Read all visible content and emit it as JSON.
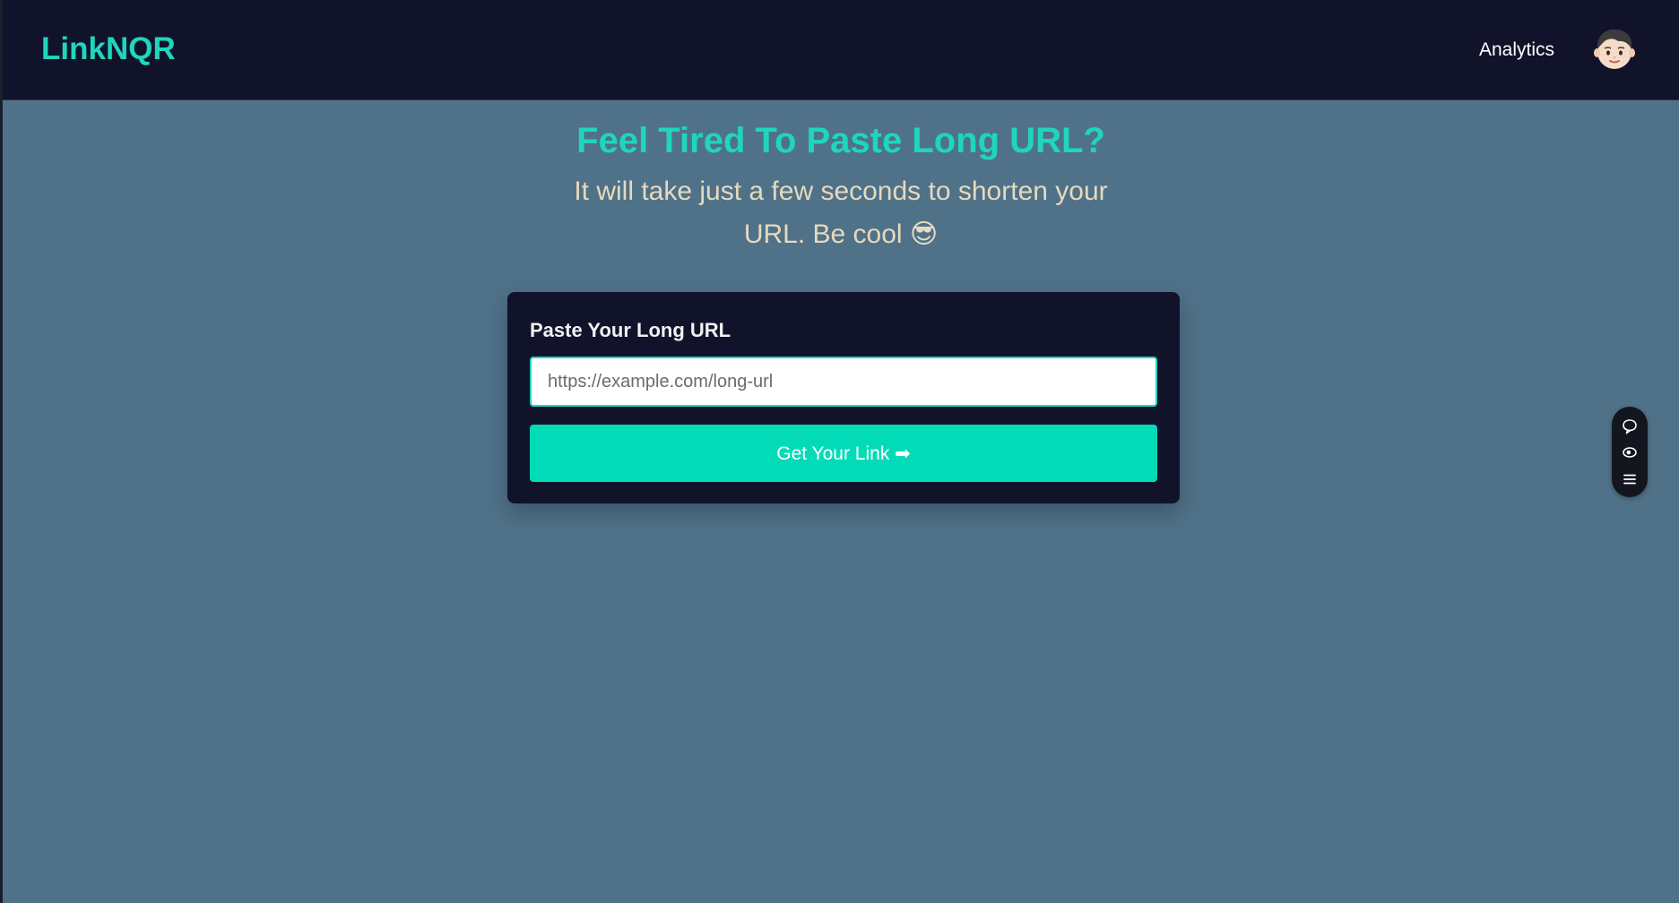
{
  "navbar": {
    "logo": "LinkNQR",
    "links": [
      {
        "label": "Analytics"
      }
    ],
    "avatar_icon": "boy-face-emoji"
  },
  "hero": {
    "title": "Feel Tired To Paste Long URL?",
    "subtitle_line1": "It will take just a few seconds to shorten your",
    "subtitle_line2": "URL. Be cool 😎"
  },
  "form": {
    "label": "Paste Your Long URL",
    "input_placeholder": "https://example.com/long-url",
    "input_value": "",
    "submit_label": "Get Your Link ➡"
  },
  "floating_toolbar": {
    "icons": [
      "chat-bubble-icon",
      "eye-icon",
      "menu-icon"
    ]
  },
  "colors": {
    "accent": "#1fd6bd",
    "button": "#03dbb8",
    "nav_background": "#11132a",
    "page_background": "#4f7289",
    "subtitle_text": "#e7d9bd"
  }
}
